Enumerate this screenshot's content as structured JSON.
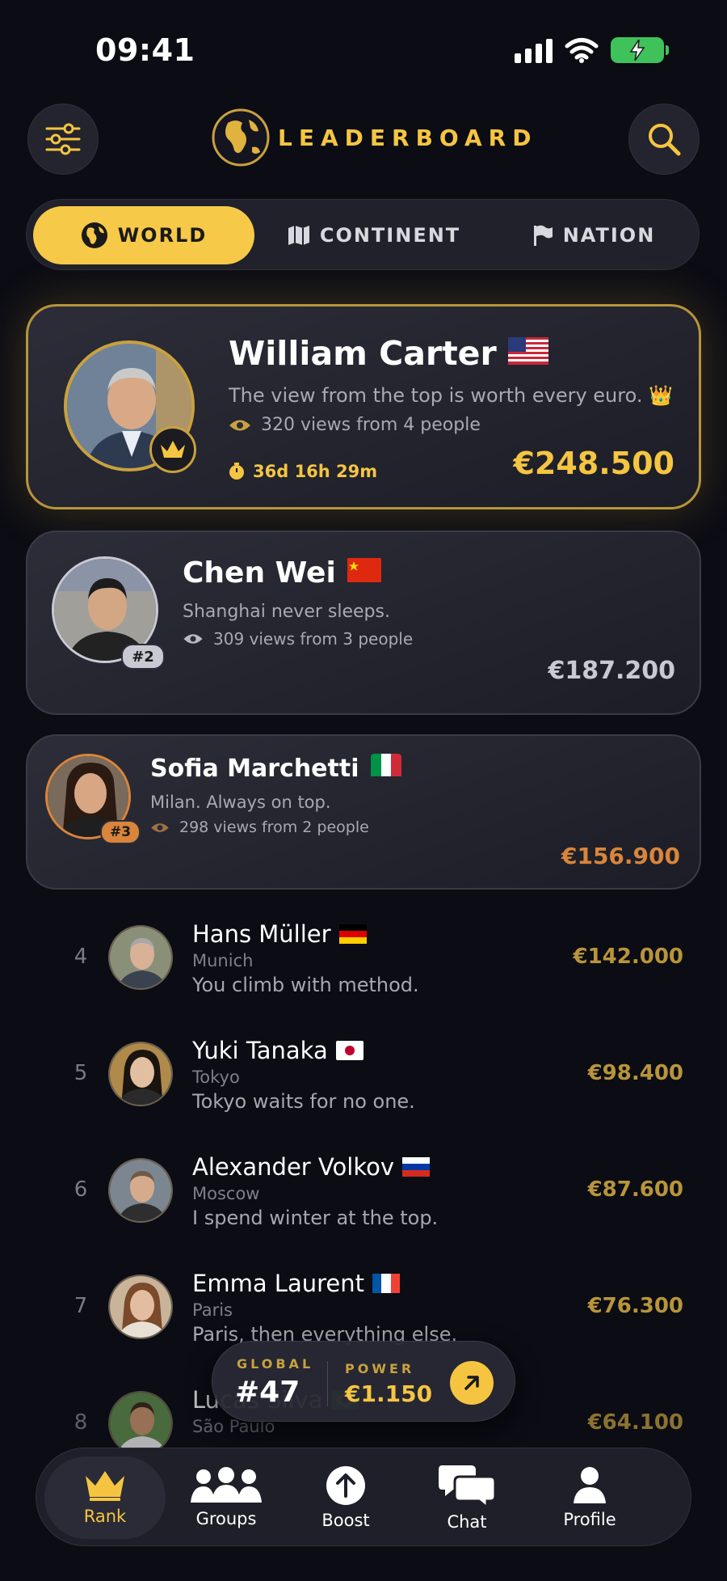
{
  "status": {
    "time": "09:41"
  },
  "header": {
    "title": "LEADERBOARD"
  },
  "segments": [
    {
      "label": "WORLD",
      "icon": "globe-icon",
      "active": true
    },
    {
      "label": "CONTINENT",
      "icon": "map-icon",
      "active": false
    },
    {
      "label": "NATION",
      "icon": "flag-icon",
      "active": false
    }
  ],
  "top": [
    {
      "rank": "#1",
      "name": "William Carter",
      "flag": "us",
      "quote": "The view from the top is worth every euro. 👑",
      "views": "320 views from 4 people",
      "timer": "36d 16h 29m",
      "amount": "€248.500"
    },
    {
      "rank": "#2",
      "name": "Chen Wei",
      "flag": "cn",
      "quote": "Shanghai never sleeps.",
      "views": "309 views from 3 people",
      "amount": "€187.200"
    },
    {
      "rank": "#3",
      "name": "Sofia Marchetti",
      "flag": "it",
      "quote": "Milan. Always on top.",
      "views": "298 views from 2 people",
      "amount": "€156.900"
    }
  ],
  "list": [
    {
      "rank": "4",
      "name": "Hans Müller",
      "flag": "de",
      "city": "Munich",
      "quote": "You climb with method.",
      "amount": "€142.000"
    },
    {
      "rank": "5",
      "name": "Yuki Tanaka",
      "flag": "jp",
      "city": "Tokyo",
      "quote": "Tokyo waits for no one.",
      "amount": "€98.400"
    },
    {
      "rank": "6",
      "name": "Alexander Volkov",
      "flag": "ru",
      "city": "Moscow",
      "quote": "I spend winter at the top.",
      "amount": "€87.600"
    },
    {
      "rank": "7",
      "name": "Emma Laurent",
      "flag": "fr",
      "city": "Paris",
      "quote": "Paris, then everything else.",
      "amount": "€76.300"
    },
    {
      "rank": "8",
      "name": "Lucas Silva",
      "flag": "br",
      "city": "São Paulo",
      "quote": "",
      "amount": "€64.100"
    }
  ],
  "pill": {
    "global_label": "GLOBAL",
    "global_value": "#47",
    "power_label": "POWER",
    "power_value": "€1.150"
  },
  "tabs": [
    {
      "label": "Rank",
      "icon": "crown-icon",
      "active": true
    },
    {
      "label": "Groups",
      "icon": "groups-icon",
      "active": false
    },
    {
      "label": "Boost",
      "icon": "boost-icon",
      "active": false
    },
    {
      "label": "Chat",
      "icon": "chat-icon",
      "active": false
    },
    {
      "label": "Profile",
      "icon": "profile-icon",
      "active": false
    }
  ],
  "colors": {
    "gold": "#f5c542",
    "bronze": "#d9853b",
    "silver": "#c8c9d2",
    "background": "#0b0c14"
  }
}
